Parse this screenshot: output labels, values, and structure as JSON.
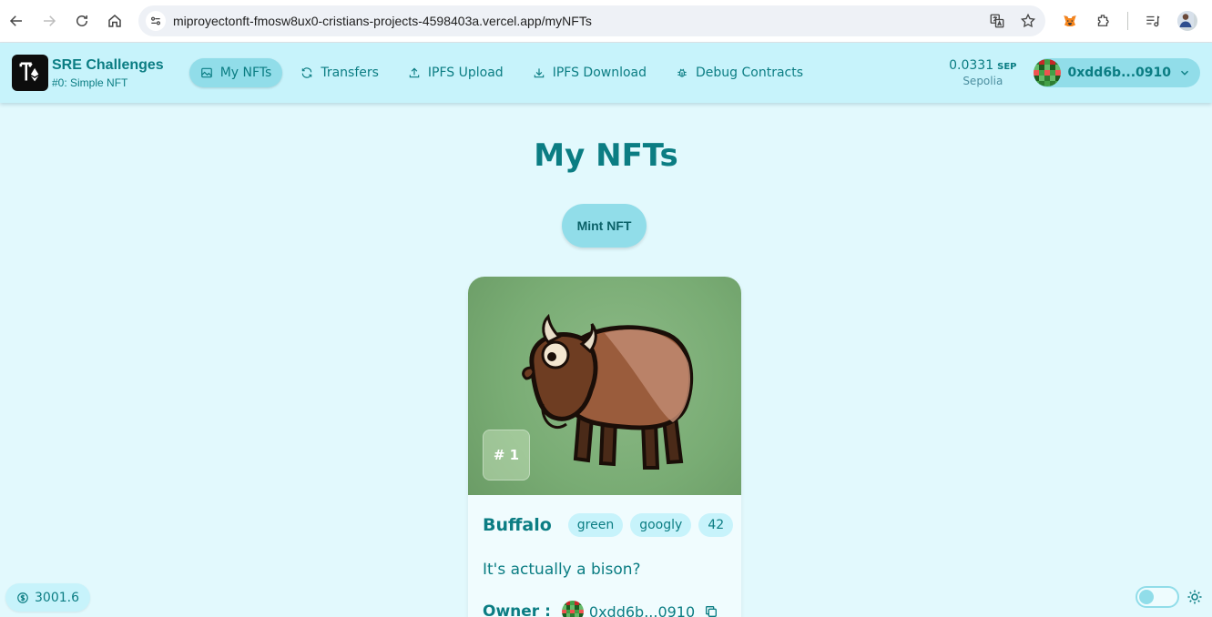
{
  "browser": {
    "url": "miproyectonft-fmosw8ux0-cristians-projects-4598403a.vercel.app/myNFTs"
  },
  "header": {
    "brand_title": "SRE Challenges",
    "brand_subtitle": "#0: Simple NFT",
    "nav": [
      {
        "label": "My NFTs",
        "icon": "image-icon",
        "active": true
      },
      {
        "label": "Transfers",
        "icon": "refresh-icon",
        "active": false
      },
      {
        "label": "IPFS Upload",
        "icon": "upload-icon",
        "active": false
      },
      {
        "label": "IPFS Download",
        "icon": "download-icon",
        "active": false
      },
      {
        "label": "Debug Contracts",
        "icon": "bug-icon",
        "active": false
      }
    ],
    "balance_value": "0.0331",
    "balance_unit": "SEP",
    "network": "Sepolia",
    "account_address": "0xdd6b...0910"
  },
  "main": {
    "title": "My NFTs",
    "mint_label": "Mint NFT",
    "nft": {
      "token_id": "# 1",
      "name": "Buffalo",
      "attributes": [
        "green",
        "googly",
        "42"
      ],
      "description": "It's actually a bison?",
      "owner_label": "Owner :",
      "owner_address": "0xdd6b...0910"
    }
  },
  "footer": {
    "price": "3001.6"
  },
  "colors": {
    "background": "#e2f9fd",
    "header": "#c7f3fb",
    "accent": "#91dde9",
    "text": "#0b7d83"
  }
}
